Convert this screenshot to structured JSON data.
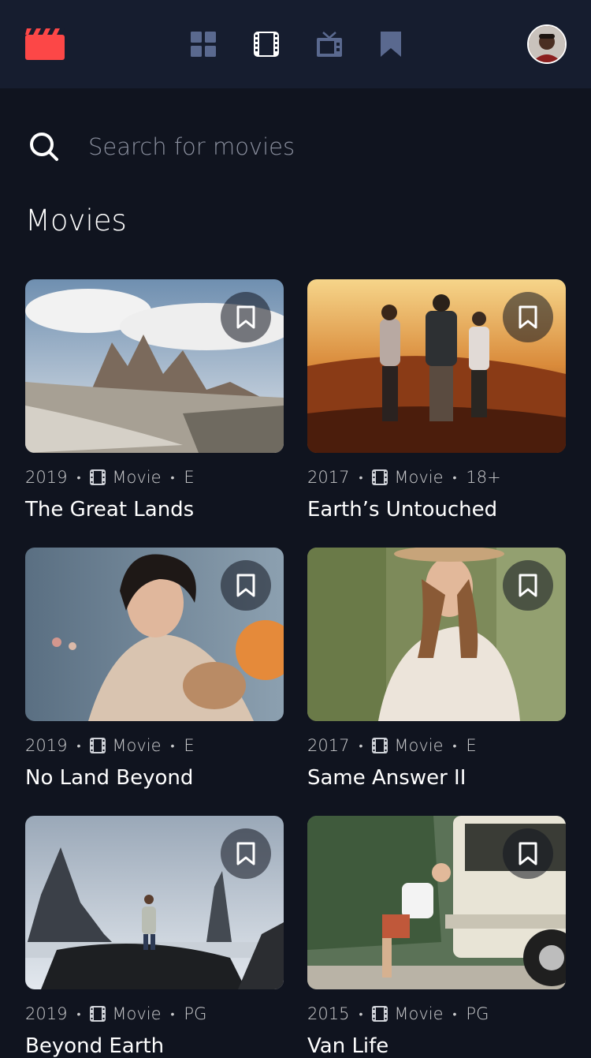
{
  "nav": {
    "items": [
      {
        "name": "home",
        "icon": "grid-icon",
        "active": false
      },
      {
        "name": "movies",
        "icon": "film-icon",
        "active": true
      },
      {
        "name": "tv-series",
        "icon": "tv-icon",
        "active": false
      },
      {
        "name": "bookmarks",
        "icon": "bookmark-icon",
        "active": false
      }
    ]
  },
  "search": {
    "placeholder": "Search for movies",
    "value": ""
  },
  "section": {
    "title": "Movies"
  },
  "movies": [
    {
      "year": "2019",
      "category": "Movie",
      "rating": "E",
      "title": "The Great Lands"
    },
    {
      "year": "2017",
      "category": "Movie",
      "rating": "18+",
      "title": "Earth’s Untouched"
    },
    {
      "year": "2019",
      "category": "Movie",
      "rating": "E",
      "title": "No Land Beyond"
    },
    {
      "year": "2017",
      "category": "Movie",
      "rating": "E",
      "title": "Same Answer II"
    },
    {
      "year": "2019",
      "category": "Movie",
      "rating": "PG",
      "title": "Beyond Earth"
    },
    {
      "year": "2015",
      "category": "Movie",
      "rating": "PG",
      "title": "Van Life"
    }
  ],
  "colors": {
    "background": "#10141f",
    "surface": "#161d2f",
    "accent": "#fc4747",
    "nav_inactive": "#5a698f",
    "text": "#ffffff"
  }
}
